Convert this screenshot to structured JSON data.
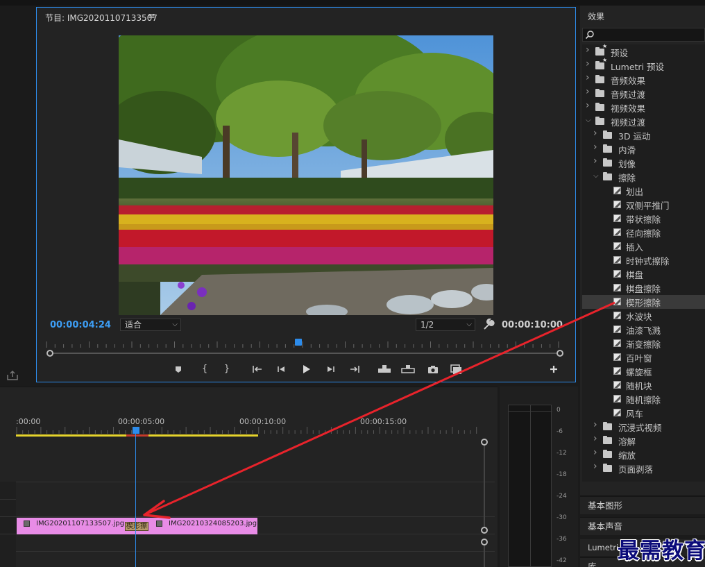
{
  "program_monitor": {
    "title_prefix": "节目: ",
    "sequence_name": "IMG20201107133507",
    "menu_icon": "≡",
    "current_time": "00:00:04:24",
    "fit_label": "适合",
    "resolution_label": "1/2",
    "duration": "00:00:10:00",
    "playhead_fraction": 0.49
  },
  "effects_panel": {
    "title": "效果",
    "search_placeholder": "",
    "rows": [
      {
        "label": "预设",
        "kind": "star-folder",
        "level": 0,
        "expanded": false
      },
      {
        "label": "Lumetri 预设",
        "kind": "star-folder",
        "level": 0,
        "expanded": false
      },
      {
        "label": "音频效果",
        "kind": "folder",
        "level": 0,
        "expanded": false
      },
      {
        "label": "音频过渡",
        "kind": "folder",
        "level": 0,
        "expanded": false
      },
      {
        "label": "视频效果",
        "kind": "folder",
        "level": 0,
        "expanded": false
      },
      {
        "label": "视频过渡",
        "kind": "folder",
        "level": 0,
        "expanded": true
      },
      {
        "label": "3D 运动",
        "kind": "folder",
        "level": 1,
        "expanded": false
      },
      {
        "label": "内滑",
        "kind": "folder",
        "level": 1,
        "expanded": false
      },
      {
        "label": "划像",
        "kind": "folder",
        "level": 1,
        "expanded": false
      },
      {
        "label": "擦除",
        "kind": "folder",
        "level": 1,
        "expanded": true
      },
      {
        "label": "划出",
        "kind": "transition",
        "level": 2
      },
      {
        "label": "双侧平推门",
        "kind": "transition",
        "level": 2
      },
      {
        "label": "带状擦除",
        "kind": "transition",
        "level": 2
      },
      {
        "label": "径向擦除",
        "kind": "transition",
        "level": 2
      },
      {
        "label": "插入",
        "kind": "transition",
        "level": 2
      },
      {
        "label": "时钟式擦除",
        "kind": "transition",
        "level": 2
      },
      {
        "label": "棋盘",
        "kind": "transition",
        "level": 2
      },
      {
        "label": "棋盘擦除",
        "kind": "transition",
        "level": 2
      },
      {
        "label": "楔形擦除",
        "kind": "transition",
        "level": 2,
        "selected": true
      },
      {
        "label": "水波块",
        "kind": "transition",
        "level": 2
      },
      {
        "label": "油漆飞溅",
        "kind": "transition",
        "level": 2
      },
      {
        "label": "渐变擦除",
        "kind": "transition",
        "level": 2
      },
      {
        "label": "百叶窗",
        "kind": "transition",
        "level": 2
      },
      {
        "label": "螺旋框",
        "kind": "transition",
        "level": 2
      },
      {
        "label": "随机块",
        "kind": "transition",
        "level": 2
      },
      {
        "label": "随机擦除",
        "kind": "transition",
        "level": 2
      },
      {
        "label": "风车",
        "kind": "transition",
        "level": 2
      },
      {
        "label": "沉浸式视频",
        "kind": "folder",
        "level": 1,
        "expanded": false
      },
      {
        "label": "溶解",
        "kind": "folder",
        "level": 1,
        "expanded": false
      },
      {
        "label": "缩放",
        "kind": "folder",
        "level": 1,
        "expanded": false
      },
      {
        "label": "页面剥落",
        "kind": "folder",
        "level": 1,
        "expanded": false
      }
    ]
  },
  "side_panels": {
    "graphics": "基本图形",
    "sound": "基本声音",
    "lumetri": "Lumetri 范围",
    "library": "库"
  },
  "timeline": {
    "ruler_labels": [
      ":00:00",
      "00:00:05:00",
      "00:00:10:00",
      "00:00:15:00"
    ],
    "clip_a": "IMG20201107133507.jpg",
    "clip_b": "IMG20210324085203.jpg",
    "transition_label": "楔形擦"
  },
  "audio_meter": {
    "scale": [
      "0",
      "-6",
      "-12",
      "-18",
      "-24",
      "-30",
      "-36",
      "-42"
    ]
  },
  "watermark": "最需教育",
  "colors": {
    "accent": "#2d8ceb",
    "timecode": "#3d9ef5",
    "clip": "#e88ce6",
    "arrow": "#e8232b",
    "work_area": "#e6d42c"
  }
}
